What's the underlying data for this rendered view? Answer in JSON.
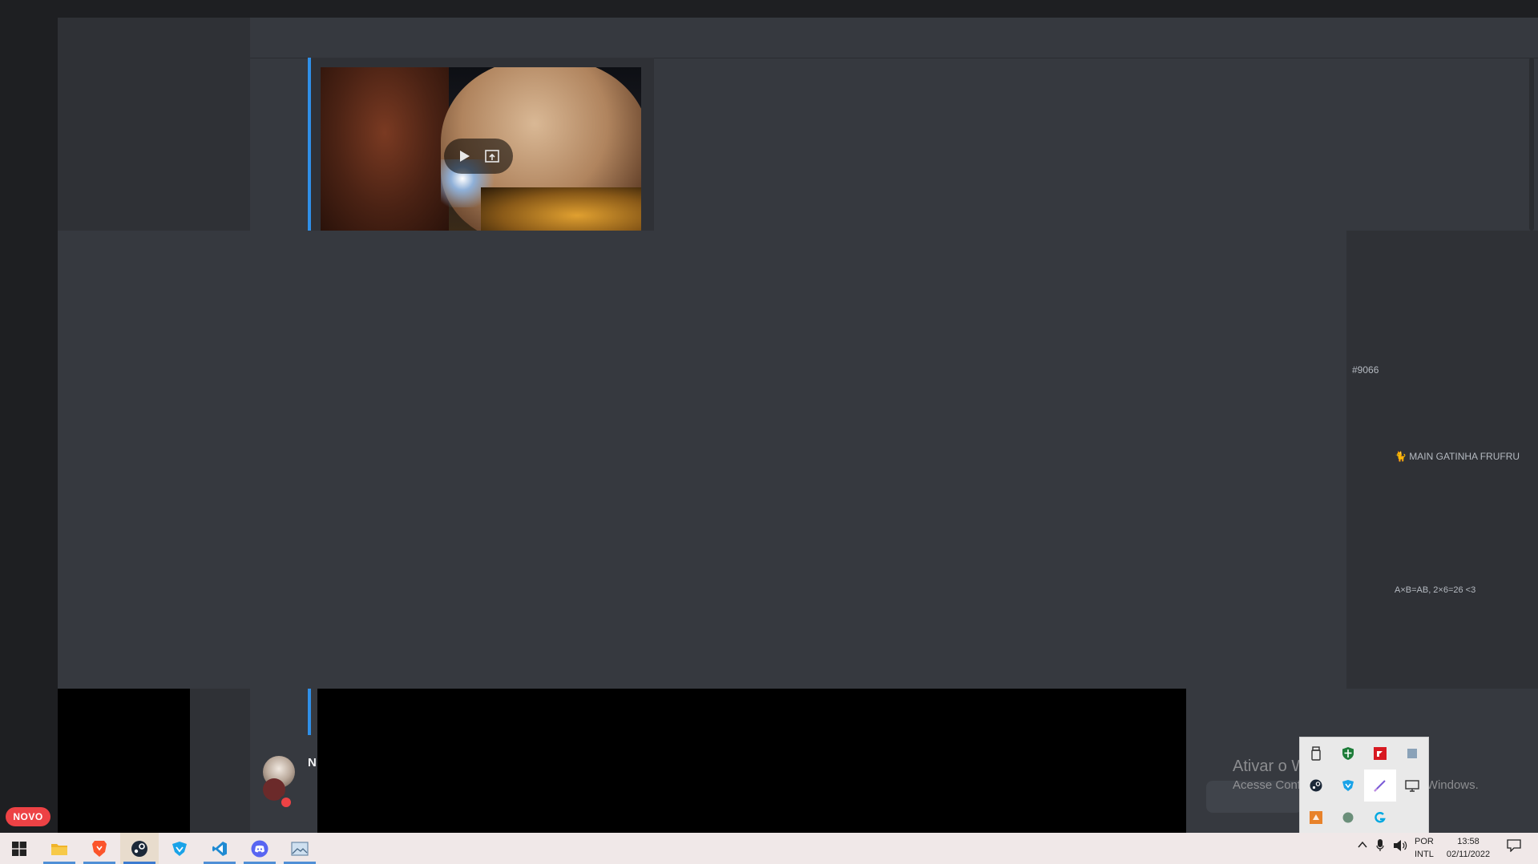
{
  "media": {
    "play_icon": "play-icon",
    "pip_icon": "picture-in-picture-icon"
  },
  "member_panel": {
    "tag": "#9066",
    "status_1": "🐈 MAIN GATINHA FRUFRU",
    "status_2": "A×B=AB, 2×6=26 <3"
  },
  "message": {
    "author_initial": "N"
  },
  "watermark": {
    "line1": "Ativar o Windows",
    "line2": "Acesse Configurações para ativar o Windows."
  },
  "tray_popup": {
    "icons": [
      "usb-drive-icon",
      "windows-security-icon",
      "amd-radeon-icon",
      "blank-app-icon",
      "steam-icon",
      "vpn-shield-icon",
      "pen-icon",
      "display-icon",
      "game-launcher-icon",
      "circle-app-icon",
      "logitech-icon"
    ]
  },
  "badge": {
    "label": "NOVO"
  },
  "taskbar": {
    "apps": [
      "windows-start-icon",
      "file-explorer-icon",
      "brave-browser-icon",
      "steam-icon",
      "vpn-icon",
      "vscode-icon",
      "discord-icon",
      "photos-icon"
    ],
    "language_line1": "POR",
    "language_line2": "INTL",
    "time": "13:58",
    "date": "02/11/2022"
  },
  "colors": {
    "accent_blue": "#2f8fe8",
    "dnd_red": "#ed4245",
    "badge_red": "#ed4245"
  }
}
